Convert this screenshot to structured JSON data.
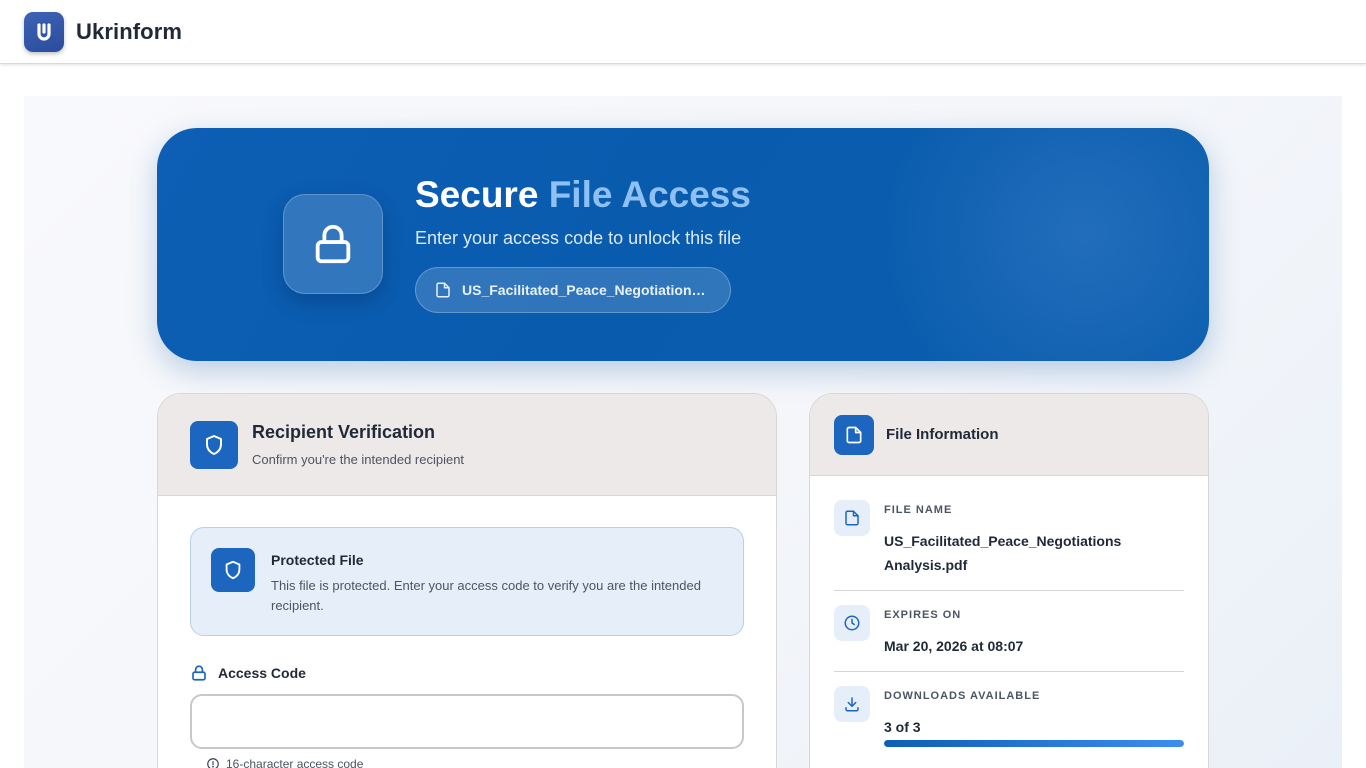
{
  "app": {
    "name": "Ukrinform"
  },
  "hero": {
    "title_part1": "Secure",
    "title_part2": "File Access",
    "subtitle": "Enter your access code to unlock this file",
    "file_name": "US_Facilitated_Peace_Negotiations …"
  },
  "verification": {
    "title": "Recipient Verification",
    "subtitle": "Confirm you're the intended recipient",
    "notice_title": "Protected File",
    "notice_text": "This file is protected. Enter your access code to verify you are the intended recipient.",
    "access_label": "Access Code",
    "access_value": "",
    "access_placeholder": "",
    "hint": "16-character access code"
  },
  "file_info": {
    "title": "File Information",
    "name_label": "FILE NAME",
    "name_value": "US_Facilitated_Peace_Negotiations Analysis.pdf",
    "expires_label": "EXPIRES ON",
    "expires_value": "Mar 20, 2026 at 08:07",
    "downloads_label": "DOWNLOADS AVAILABLE",
    "downloads_value": "3 of 3",
    "downloads_fraction": 1.0
  },
  "colors": {
    "primary": "#1c66c0",
    "hero_bg": "#0a5eae",
    "hero_accent_text": "#8ec0f4",
    "notice_bg": "#e6eff9"
  },
  "icons": {
    "logo": "ukrinform-logo-icon",
    "hero": "lock-icon",
    "file_pill": "file-icon",
    "verification": "shield-icon",
    "notice": "shield-icon",
    "access": "lock-icon",
    "hint": "info-circle-icon",
    "file_info": "file-icon",
    "name": "file-icon",
    "expires": "clock-icon",
    "downloads": "download-icon"
  }
}
